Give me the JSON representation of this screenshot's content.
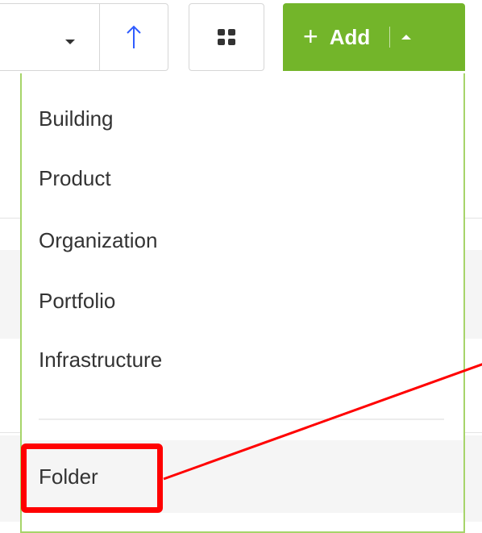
{
  "toolbar": {
    "sort_select": {
      "value": ""
    },
    "sort_direction": {
      "icon": "arrow-up-icon"
    },
    "view_toggle": {
      "icon": "grid-view-icon"
    },
    "add_button": {
      "plus": "+",
      "label": "Add",
      "icon": "caret-up-icon"
    }
  },
  "add_menu": {
    "items": [
      {
        "label": "Building"
      },
      {
        "label": "Product"
      },
      {
        "label": "Organization"
      },
      {
        "label": "Portfolio"
      },
      {
        "label": "Infrastructure"
      }
    ],
    "folder_item": {
      "label": "Folder"
    }
  },
  "colors": {
    "accent_green": "#73b52a",
    "menu_border": "#a6d46a",
    "arrow_blue": "#2f5cff",
    "annotation_red": "#ff0000"
  }
}
